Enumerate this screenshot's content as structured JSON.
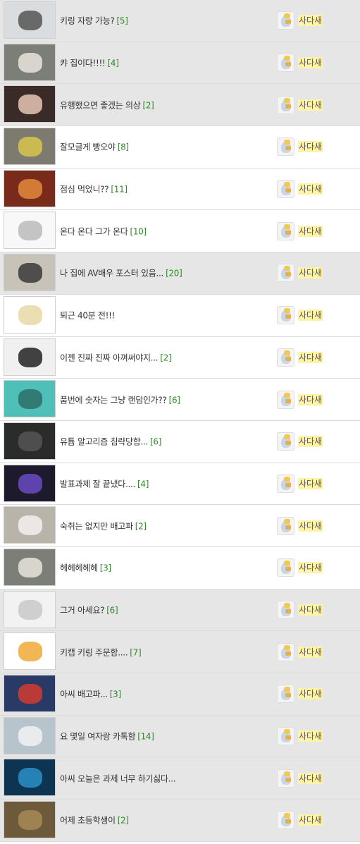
{
  "posts": [
    {
      "title": "키링 자랑 가능?",
      "count": "[5]",
      "author": "사다새",
      "thumb": "keyring-thumb",
      "bg": "#d9dde0",
      "shade": "#555"
    },
    {
      "title": "캬 집이다!!!!",
      "count": "[4]",
      "author": "사다새",
      "thumb": "dog-thumb",
      "bg": "#7c7f78",
      "shade": "#e9e4dc"
    },
    {
      "title": "유행했으면 좋겠는 의상",
      "count": "[2]",
      "author": "사다새",
      "thumb": "person-thumb",
      "bg": "#3a2b28",
      "shade": "#e7c6b4"
    },
    {
      "title": "잘모글게 빵오야",
      "count": "[8]",
      "author": "사다새",
      "thumb": "street-thumb",
      "bg": "#7d7a70",
      "shade": "#d7c64b"
    },
    {
      "title": "점심 먹었니??",
      "count": "[11]",
      "author": "사다새",
      "thumb": "food-thumb",
      "bg": "#7a2a1a",
      "shade": "#e08a3c"
    },
    {
      "title": "온다 온다 그가 온다",
      "count": "[10]",
      "author": "사다새",
      "thumb": "text-thumb",
      "bg": "#f8f8f8",
      "shade": "#bbb"
    },
    {
      "title": "나 집에 AV배우 포스터 있음...",
      "count": "[20]",
      "author": "사다새",
      "thumb": "bag-thumb",
      "bg": "#c7c3b8",
      "shade": "#3a3a3a"
    },
    {
      "title": "퇴근 40분 전!!!",
      "count": "",
      "author": "사다새",
      "thumb": "cartoon-thumb",
      "bg": "#ffffff",
      "shade": "#e9d8a6"
    },
    {
      "title": "이젠 진짜 진짜 아껴써야지...",
      "count": "[2]",
      "author": "사다새",
      "thumb": "manga-thumb",
      "bg": "#f0f0f0",
      "shade": "#222"
    },
    {
      "title": "품번에 숫자는 그냥 랜덤인가??",
      "count": "[6]",
      "author": "사다새",
      "thumb": "squid-thumb",
      "bg": "#4fc0b8",
      "shade": "#2d6e68"
    },
    {
      "title": "유튭 알고리즘 침략당함...",
      "count": "[6]",
      "author": "사다새",
      "thumb": "phone-thumb",
      "bg": "#2a2c2c",
      "shade": "#555"
    },
    {
      "title": "발표과제 잘 끝냈다....",
      "count": "[4]",
      "author": "사다새",
      "thumb": "screen-thumb",
      "bg": "#1e1a2e",
      "shade": "#6a4bc2"
    },
    {
      "title": "숙취는 없지만 배고파",
      "count": "[2]",
      "author": "사다새",
      "thumb": "blossom-thumb",
      "bg": "#b9b4aa",
      "shade": "#f4eef0"
    },
    {
      "title": "헤헤헤헤헤",
      "count": "[3]",
      "author": "사다새",
      "thumb": "dog2-thumb",
      "bg": "#7c7f78",
      "shade": "#e9e4dc"
    },
    {
      "title": "그거 아세요?",
      "count": "[6]",
      "author": "사다새",
      "thumb": "placeholder-thumb",
      "bg": "#f2f2f2",
      "shade": "#c9c9c9"
    },
    {
      "title": "키캡 키링 주문함....",
      "count": "[7]",
      "author": "사다새",
      "thumb": "pelican-thumb",
      "bg": "#ffffff",
      "shade": "#f0a93a"
    },
    {
      "title": "아씨 배고파...",
      "count": "[3]",
      "author": "사다새",
      "thumb": "holiday-thumb",
      "bg": "#2a3a66",
      "shade": "#d43b2f"
    },
    {
      "title": "요 몇일 여자랑 카톡함",
      "count": "[14]",
      "author": "사다새",
      "thumb": "paper-thumb",
      "bg": "#b7c4cc",
      "shade": "#f2f2f2"
    },
    {
      "title": "아씨 오늘은 과제 너무 하기싫다...",
      "count": "",
      "author": "사다새",
      "thumb": "singer-thumb",
      "bg": "#0d3552",
      "shade": "#2c8fc7"
    },
    {
      "title": "어제 초등학생이",
      "count": "[2]",
      "author": "사다새",
      "thumb": "grass-thumb",
      "bg": "#6d5a3a",
      "shade": "#a88a56"
    }
  ],
  "rowTone": [
    "gray",
    "gray",
    "gray",
    "white",
    "white",
    "white",
    "gray",
    "white",
    "white",
    "white",
    "white",
    "white",
    "white",
    "white",
    "gray",
    "gray",
    "gray",
    "gray",
    "gray",
    "gray"
  ],
  "colors": {
    "count": "#2f8a26",
    "nick_bg": "#fff3a8",
    "row_gray": "#e6e6e6"
  }
}
